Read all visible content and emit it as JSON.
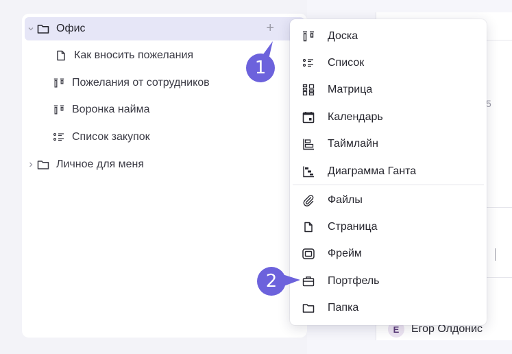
{
  "sidebar": {
    "items": [
      {
        "label": "Офис",
        "icon": "folder-icon",
        "expanded": true
      },
      {
        "label": "Как вносить пожелания",
        "icon": "page-icon"
      },
      {
        "label": "Пожелания от сотрудников",
        "icon": "board-icon"
      },
      {
        "label": "Воронка найма",
        "icon": "board-icon"
      },
      {
        "label": "Список закупок",
        "icon": "list-icon"
      },
      {
        "label": "Личное для меня",
        "icon": "folder-icon",
        "expanded": false
      }
    ],
    "add_label": "+"
  },
  "menu": {
    "items": [
      {
        "label": "Доска",
        "icon": "board-icon"
      },
      {
        "label": "Список",
        "icon": "list-icon"
      },
      {
        "label": "Матрица",
        "icon": "matrix-icon"
      },
      {
        "label": "Календарь",
        "icon": "calendar-icon"
      },
      {
        "label": "Таймлайн",
        "icon": "timeline-icon"
      },
      {
        "label": "Диаграмма Ганта",
        "icon": "gantt-icon"
      },
      {
        "label": "Файлы",
        "icon": "paperclip-icon"
      },
      {
        "label": "Страница",
        "icon": "page-icon"
      },
      {
        "label": "Фрейм",
        "icon": "frame-icon"
      },
      {
        "label": "Портфель",
        "icon": "briefcase-icon"
      },
      {
        "label": "Папка",
        "icon": "folder-icon"
      }
    ]
  },
  "callouts": {
    "one": "1",
    "two": "2"
  },
  "background": {
    "partial_number": "5",
    "user_initial": "Е",
    "user_name": "Егор Олдонис"
  },
  "colors": {
    "accent": "#6c62dc",
    "selected_row": "#e6e6f7"
  }
}
